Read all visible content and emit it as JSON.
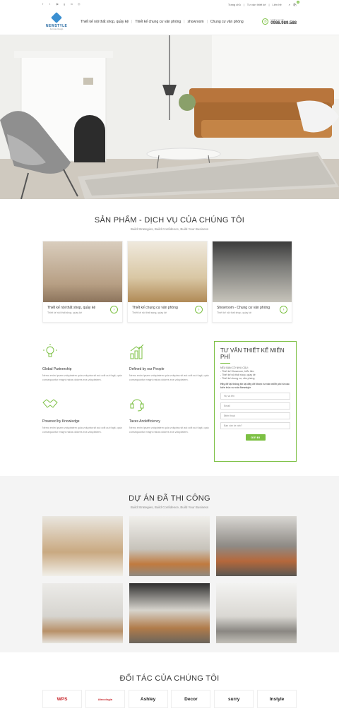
{
  "topbar": {
    "links": [
      "Trang chủ",
      "Tư vấn thiết kế",
      "Liên hệ"
    ],
    "social": [
      "facebook-icon",
      "twitter-icon",
      "youtube-icon",
      "google-plus-icon",
      "linkedin-icon",
      "instagram-icon"
    ],
    "cart_count": "0"
  },
  "header": {
    "logo_text": "NEWSTYLE",
    "logo_sub": "Furniture Design",
    "nav": [
      "Thiết kế nội thất shop, quầy kệ",
      "Thiết kế chung cư văn phòng",
      "showroom",
      "Chung cư văn phòng"
    ],
    "hotline_label": "Hotline tư vấn",
    "hotline": "0986.989.588"
  },
  "services": {
    "title": "SẢN PHẨM - DỊCH VỤ CỦA CHÚNG TÔI",
    "subtitle": "Build Strategies, Build Confidence, Build Your Business",
    "cards": [
      {
        "title": "Thiết kế nội thất shop, quầy kệ",
        "sub": "Thiết kế nội thất shop, quầy kệ"
      },
      {
        "title": "Thiết kế chung cư văn phòng",
        "sub": "Thiết kế nội thất sang, quầy kệ"
      },
      {
        "title": "Showroom - Chung cư văn phòng",
        "sub": "Thiết kế nội thất shop, quầy kệ"
      }
    ]
  },
  "features": [
    {
      "title": "Global Partnership",
      "desc": "Nemo enim ipsam voluptatem quia voluptas sit aut odit aut fugit, quia consequuntur magni natus dolores eos voluptatem."
    },
    {
      "title": "Defined by our People",
      "desc": "Nemo enim ipsam voluptatem quia voluptas sit aut odit aut fugit, quia consequuntur magni natus dolores eos voluptatem."
    },
    {
      "title": "Powered by Knowledge",
      "desc": "Nemo enim ipsam voluptatem quia voluptas sit aut odit aut fugit, quia consequuntur magni natus dolores eos voluptatem."
    },
    {
      "title": "Taxes Andefficiency",
      "desc": "Nemo enim ipsam voluptatem quia voluptas sit aut odit aut fugit, quia consequuntur magni natus dolores eos voluptatem."
    }
  ],
  "form": {
    "title": "TƯ VẤN THIẾT KẾ MIỄN PHÍ",
    "need": "NẾU BẠN CÓ NHU CẦU:",
    "items": [
      "- Thiết kế Showroom, triển lãm",
      "- Thiết kế nội thất shop, quầy kệ",
      "- Thiết kế chung cư, văn phòng"
    ],
    "note": "Hãy để lại thông tin tại đây để được tư vấn miễn phí từ các kiến trúc sư của Newstyle",
    "fields": [
      "Họ và tên",
      "Email",
      "Điện thoại",
      "Bạn cần tư vấn?"
    ],
    "button": "GỬI ĐI"
  },
  "projects": {
    "title": "DỰ ÁN ĐÃ THI CÔNG",
    "subtitle": "Build Strategies, Build Confidence, Build Your Business"
  },
  "partners": {
    "title": "ĐỐI TÁC CỦA CHÚNG TÔI",
    "logos": [
      "WPS",
      "Atecologia",
      "Ashley",
      "Decor",
      "surry",
      "Instyle"
    ]
  },
  "colors": {
    "accent": "#7cc043",
    "brand": "#2b6ca3"
  }
}
